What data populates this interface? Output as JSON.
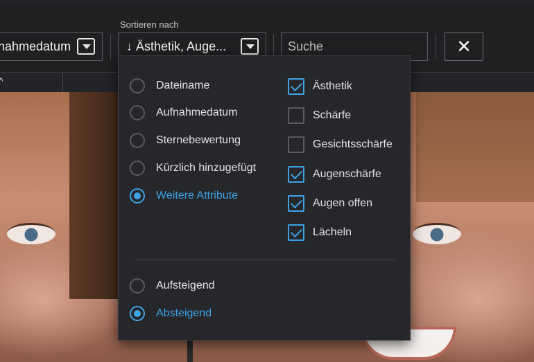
{
  "toolbar": {
    "left_combo_text": "nahmedatum",
    "sort_label": "Sortieren nach",
    "sort_arrow": "↓",
    "sort_combo_text": "Ästhetik, Auge...",
    "search": {
      "value": "",
      "placeholder": "Suche"
    },
    "close_glyph": "✕"
  },
  "subbar": {
    "sort_caret": "^"
  },
  "panel": {
    "sort_fields": [
      {
        "label": "Dateiname",
        "selected": false
      },
      {
        "label": "Aufnahmedatum",
        "selected": false
      },
      {
        "label": "Sternebewertung",
        "selected": false
      },
      {
        "label": "Kürzlich hinzugefügt",
        "selected": false
      },
      {
        "label": "Weitere Attribute",
        "selected": true
      }
    ],
    "attributes": [
      {
        "label": "Ästhetik",
        "checked": true
      },
      {
        "label": "Schärfe",
        "checked": false
      },
      {
        "label": "Gesichtsschärfe",
        "checked": false
      },
      {
        "label": "Augenschärfe",
        "checked": true
      },
      {
        "label": "Augen offen",
        "checked": true
      },
      {
        "label": "Lächeln",
        "checked": true
      }
    ],
    "order": [
      {
        "label": "Aufsteigend",
        "selected": false
      },
      {
        "label": "Absteigend",
        "selected": true
      }
    ]
  },
  "colors": {
    "accent": "#3ea2e6",
    "panel_bg": "#26272a",
    "toolbar_bg": "#1f2022"
  }
}
